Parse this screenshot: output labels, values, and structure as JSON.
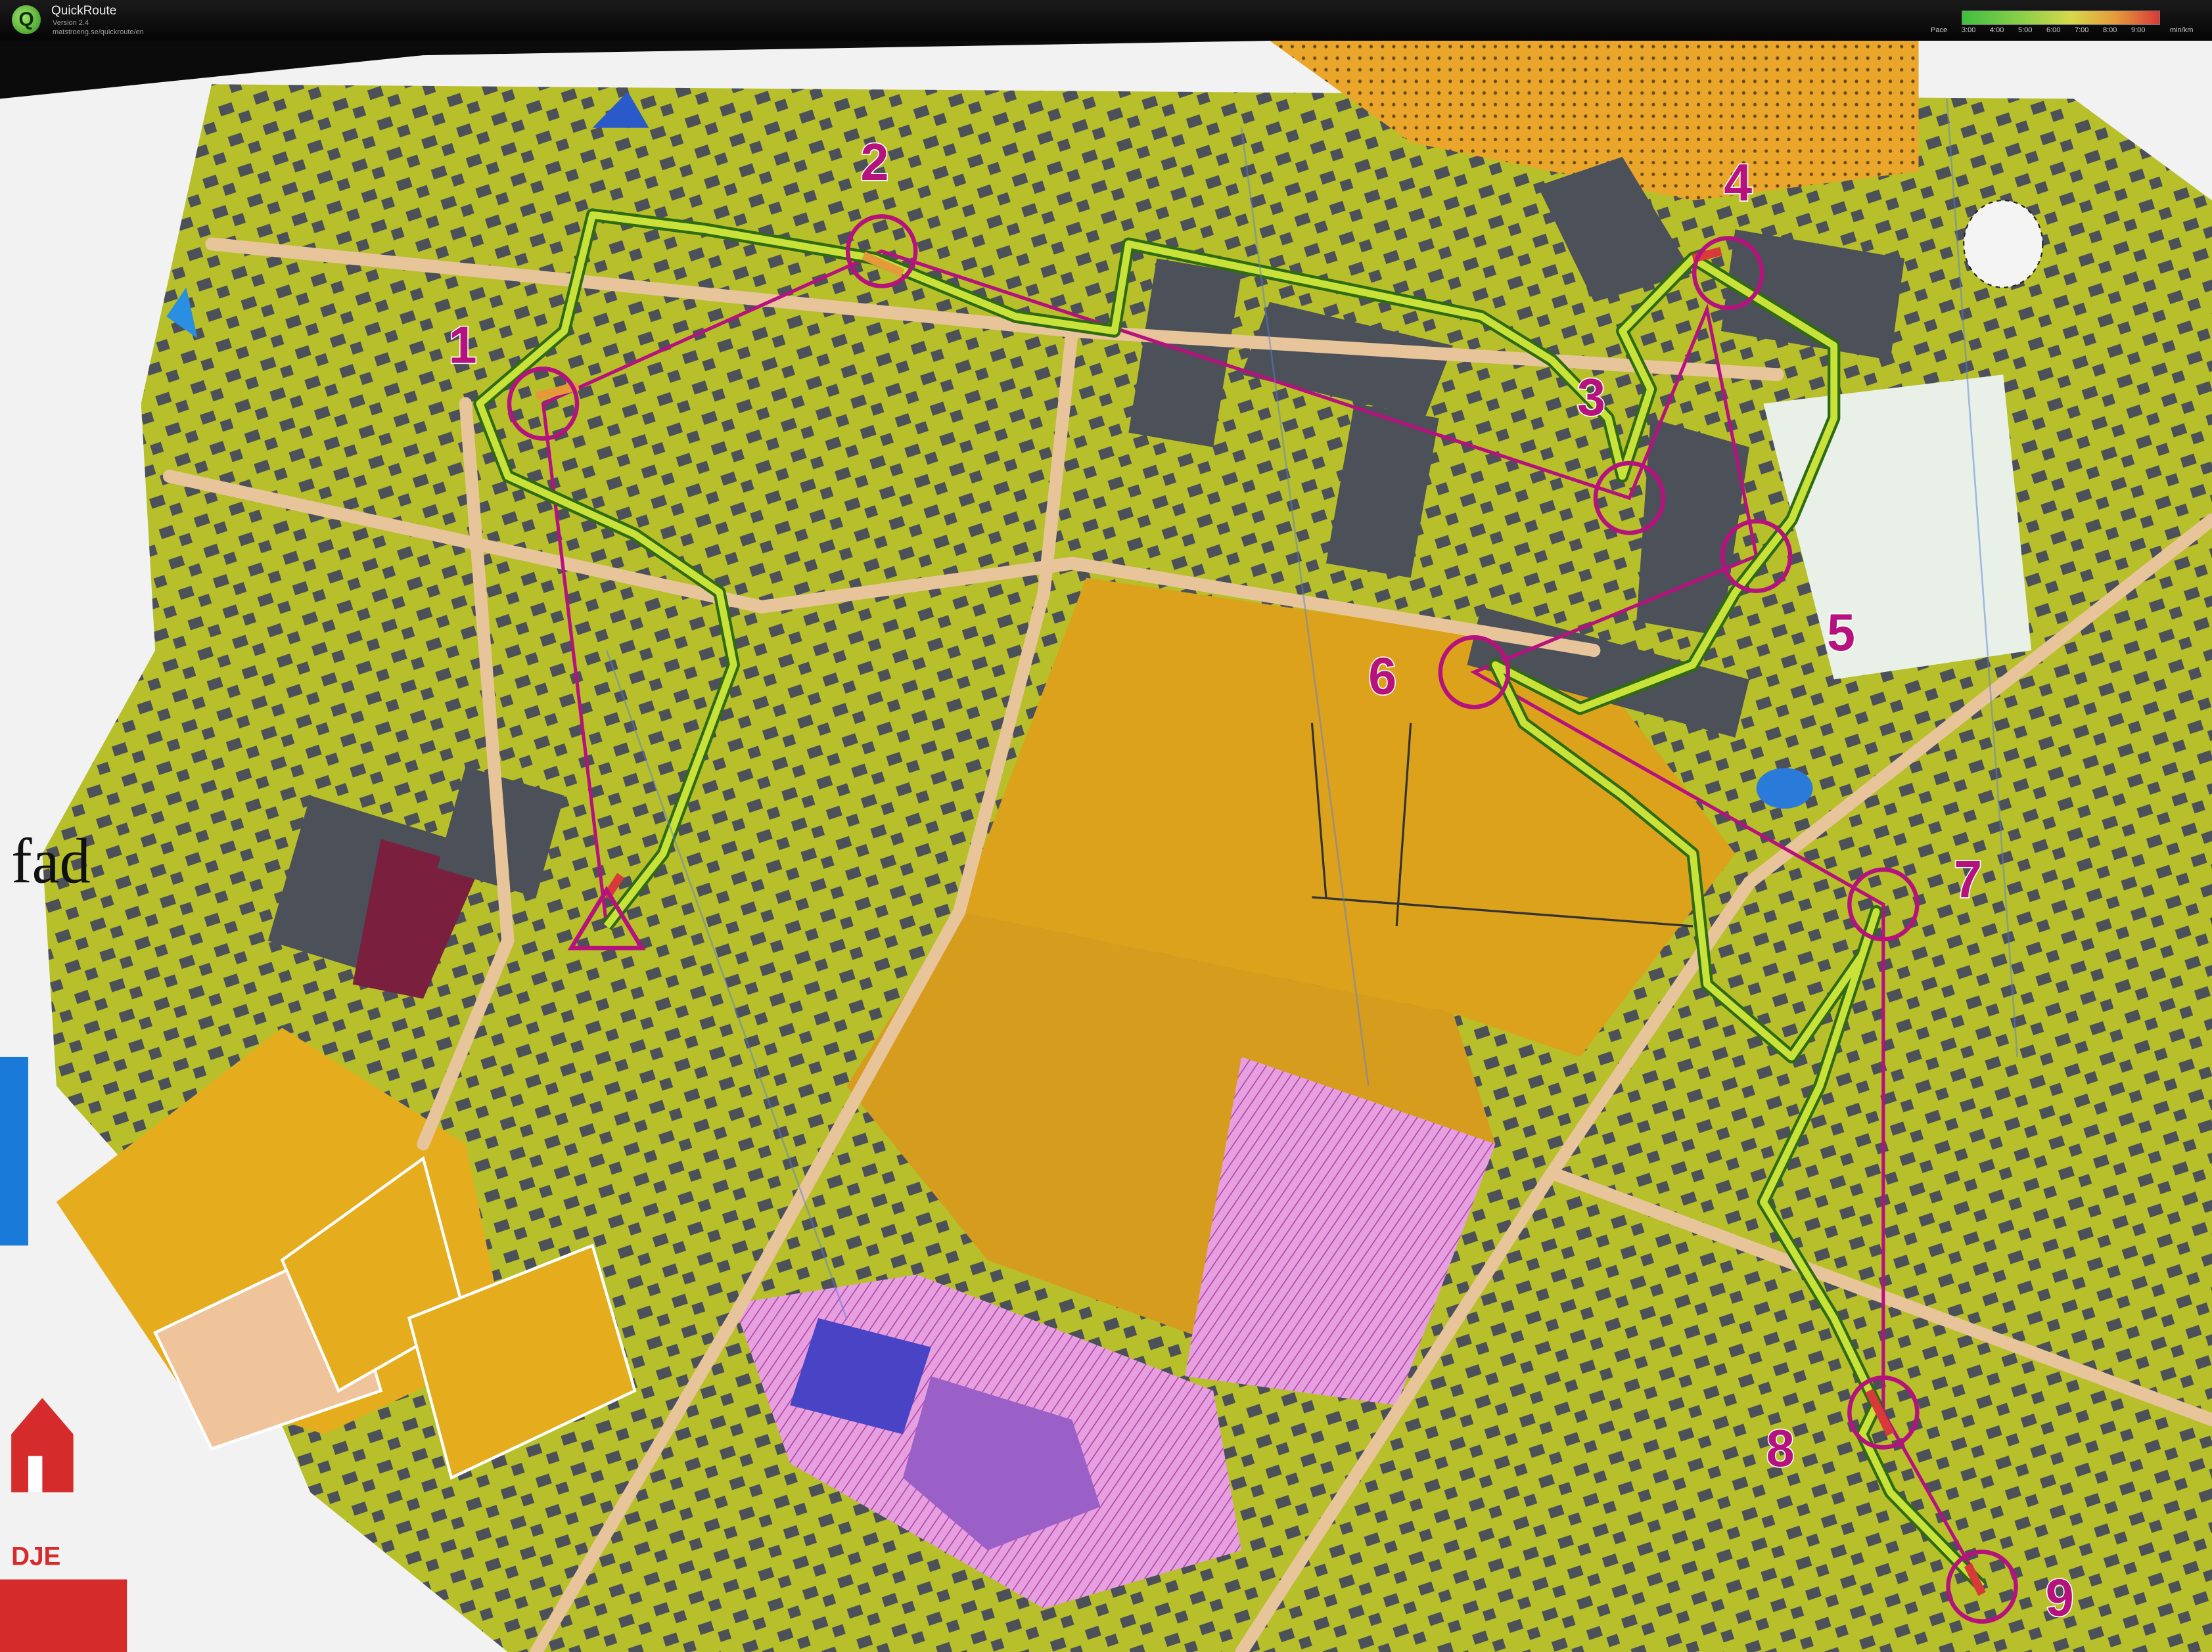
{
  "app": {
    "title": "QuickRoute",
    "version": "Version 2.4",
    "url": "matstroeng.se/quickroute/en"
  },
  "pace_legend": {
    "label": "Pace",
    "ticks": [
      "3:00",
      "4:00",
      "5:00",
      "6:00",
      "7:00",
      "8:00",
      "9:00"
    ],
    "unit": "min/km",
    "colors": [
      "#3fbf3f",
      "#8ad04a",
      "#d6d84a",
      "#e59a3a",
      "#d83a3a"
    ]
  },
  "map": {
    "controls": [
      {
        "id": 1,
        "label": "1"
      },
      {
        "id": 2,
        "label": "2"
      },
      {
        "id": 3,
        "label": "3"
      },
      {
        "id": 4,
        "label": "4"
      },
      {
        "id": 5,
        "label": "5"
      },
      {
        "id": 6,
        "label": "6"
      },
      {
        "id": 7,
        "label": "7"
      },
      {
        "id": 8,
        "label": "8"
      },
      {
        "id": 9,
        "label": "9"
      }
    ],
    "fragment_text": "fad",
    "fragment_text_2": "DJE",
    "colors": {
      "settlement": "#b7bf2a",
      "open_land": "#e0a51c",
      "building": "#4c5058",
      "road": "#e8c49a",
      "course": "#b5127e",
      "route_main": "#c9e23a",
      "route_outline": "#2f6b12",
      "restricted": "#e48ee0",
      "paper": "#f2f2f2"
    }
  }
}
